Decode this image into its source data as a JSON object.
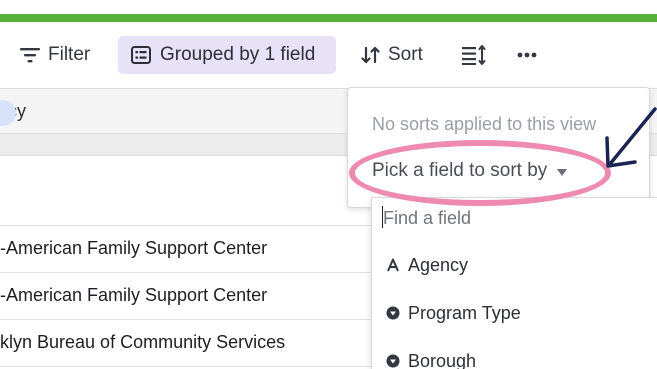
{
  "toolbar": {
    "filter_label": "Filter",
    "grouped_label": "Grouped by 1 field",
    "sort_label": "Sort"
  },
  "grid": {
    "column_header": "cy",
    "rows": [
      "-American Family Support Center",
      "-American Family Support Center",
      "klyn Bureau of Community Services"
    ]
  },
  "sort_panel": {
    "empty_message": "No sorts applied to this view",
    "pick_field_label": "Pick a field to sort by"
  },
  "field_list": {
    "search_placeholder": "Find a field",
    "options": [
      {
        "label": "Agency",
        "icon": "text-type-icon"
      },
      {
        "label": "Program Type",
        "icon": "single-select-icon"
      },
      {
        "label": "Borough",
        "icon": "single-select-icon"
      }
    ]
  },
  "colors": {
    "top_bar": "#55b13a",
    "grouped_highlight": "#e8e2f8",
    "annotation_ellipse": "#ee8ab0",
    "annotation_arrow": "#1b2452"
  }
}
